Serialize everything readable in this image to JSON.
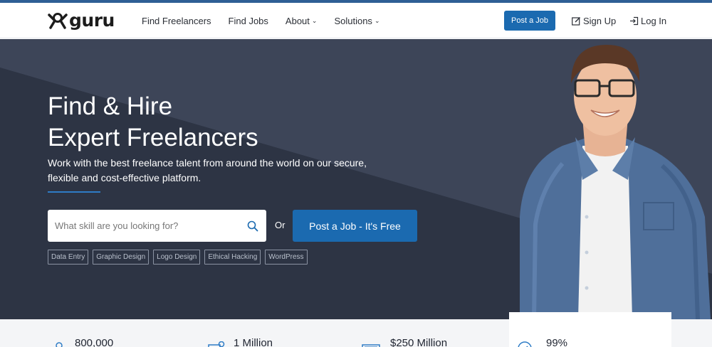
{
  "header": {
    "logo_text": "guru",
    "nav": [
      {
        "label": "Find Freelancers",
        "dropdown": false
      },
      {
        "label": "Find Jobs",
        "dropdown": false
      },
      {
        "label": "About",
        "dropdown": true
      },
      {
        "label": "Solutions",
        "dropdown": true
      }
    ],
    "post_job_label": "Post a Job",
    "signup_label": "Sign Up",
    "login_label": "Log In"
  },
  "hero": {
    "title_line1": "Find & Hire",
    "title_line2": "Expert Freelancers",
    "subtitle_line1": "Work with the best freelance talent from around the world on our secure,",
    "subtitle_line2": "flexible and cost-effective platform.",
    "search": {
      "placeholder": "What skill are you looking for?",
      "value": ""
    },
    "or_label": "Or",
    "post_job_label": "Post a Job - It's Free",
    "tags": [
      "Data Entry",
      "Graphic Design",
      "Logo Design",
      "Ethical Hacking",
      "WordPress"
    ]
  },
  "stats": [
    {
      "value": "800,000",
      "icon": "user-icon"
    },
    {
      "value": "1 Million",
      "icon": "money-icon"
    },
    {
      "value": "$250 Million",
      "icon": "cash-icon"
    },
    {
      "value": "99%",
      "icon": "check-icon"
    }
  ],
  "colors": {
    "accent": "#1b6ab0",
    "hero_bg": "#333b4b",
    "header_stripe": "#2f5f95"
  }
}
